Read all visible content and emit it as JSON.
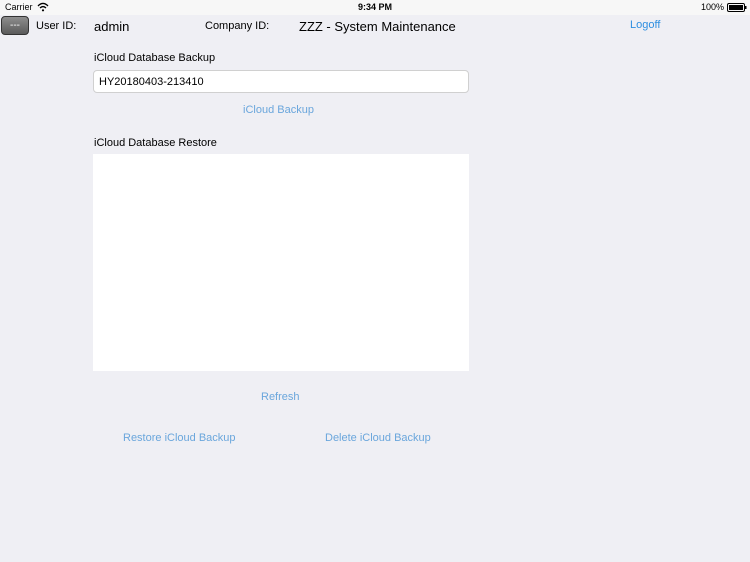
{
  "status_bar": {
    "carrier": "Carrier",
    "time": "9:34 PM",
    "battery": "100%"
  },
  "header": {
    "menu_label": "---",
    "user_id_label": "User ID:",
    "user_id": "admin",
    "company_id_label": "Company ID:",
    "company_id": "ZZZ - System Maintenance",
    "logoff_label": "Logoff"
  },
  "backup": {
    "section_label": "iCloud Database Backup",
    "filename_value": "HY20180403-213410",
    "backup_button_label": "iCloud Backup"
  },
  "restore": {
    "section_label": "iCloud Database Restore",
    "backups": [],
    "refresh_label": "Refresh",
    "restore_button_label": "Restore iCloud Backup",
    "delete_button_label": "Delete iCloud Backup"
  },
  "colors": {
    "background": "#efeff4",
    "link": "#6aa6dc",
    "logoff": "#2d8ee0"
  },
  "icons": [
    "wifi-icon",
    "battery-icon"
  ]
}
